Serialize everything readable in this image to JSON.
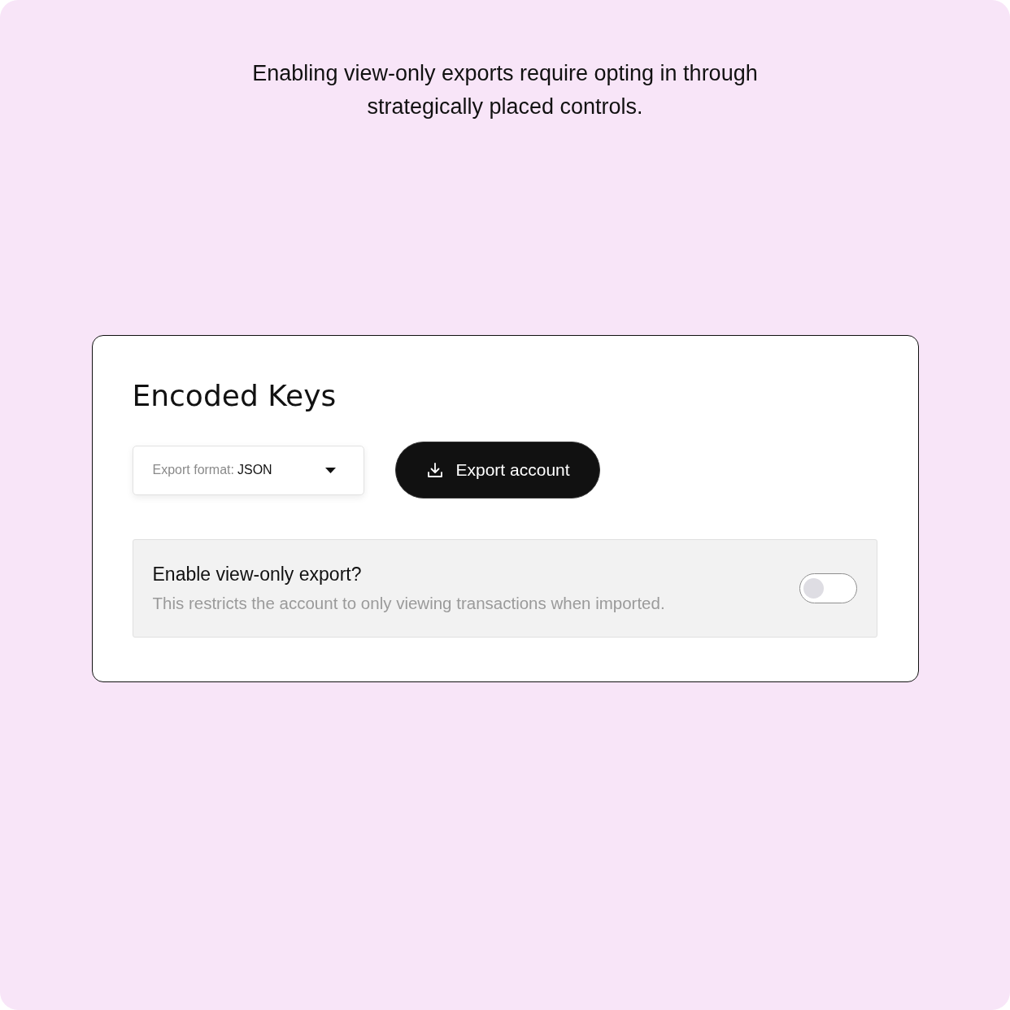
{
  "caption": "Enabling view-only exports require opting in through strategically placed controls.",
  "card": {
    "title": "Encoded Keys",
    "format_select": {
      "label": "Export format:",
      "value": "JSON"
    },
    "export_button": {
      "label": "Export account"
    },
    "view_only": {
      "title": "Enable view-only export?",
      "description": "This restricts the account to only viewing transactions when imported.",
      "on": false
    }
  }
}
